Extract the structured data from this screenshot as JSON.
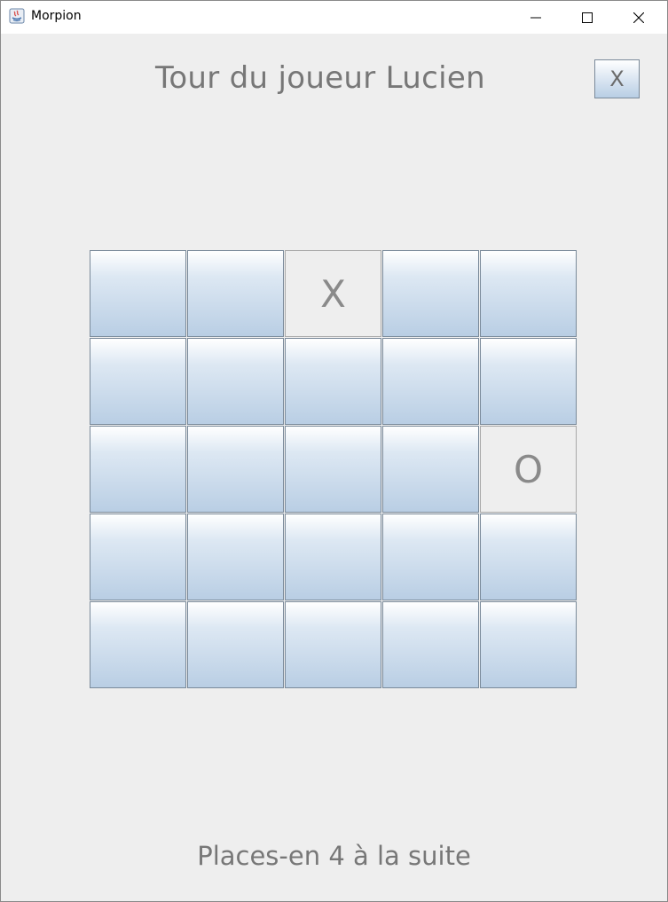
{
  "window": {
    "title": "Morpion",
    "app_icon": "java-icon",
    "controls": {
      "minimize_icon": "minimize-icon",
      "maximize_icon": "maximize-icon",
      "close_icon": "close-icon"
    }
  },
  "header": {
    "turn_text": "Tour du joueur Lucien",
    "quit_button_label": "X"
  },
  "board": {
    "rows": 5,
    "cols": 5,
    "cells": [
      [
        "",
        "",
        "X",
        "",
        ""
      ],
      [
        "",
        "",
        "",
        "",
        ""
      ],
      [
        "",
        "",
        "",
        "",
        "O"
      ],
      [
        "",
        "",
        "",
        "",
        ""
      ],
      [
        "",
        "",
        "",
        "",
        ""
      ]
    ]
  },
  "footer": {
    "hint_text": "Places-en 4 à la suite"
  },
  "colors": {
    "background": "#eeeeee",
    "button_gradient_top": "#ffffff",
    "button_gradient_bottom": "#b8cee4",
    "text": "#777777"
  }
}
